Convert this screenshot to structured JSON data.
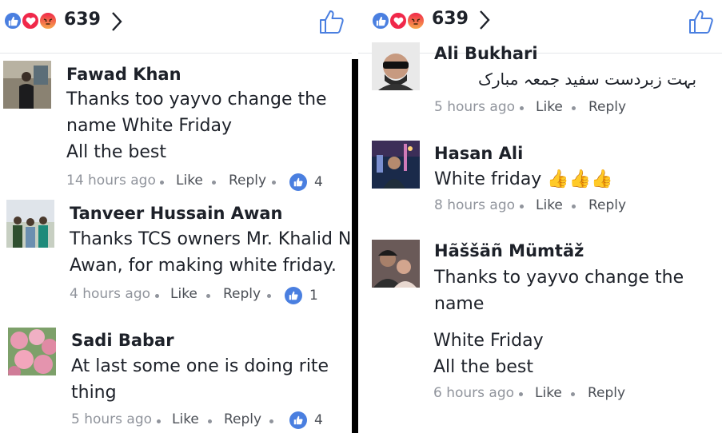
{
  "left_panel": {
    "reaction_count": "639",
    "comments": [
      {
        "author": "Fawad Khan",
        "lines": [
          "Thanks too yayvo change the",
          "name White Friday",
          "All the best"
        ],
        "time": "14 hours ago",
        "like_label": "Like",
        "reply_label": "Reply",
        "likes": "4"
      },
      {
        "author": "Tanveer Hussain Awan",
        "lines": [
          "Thanks TCS owners Mr. Khalid N",
          "Awan, for making white friday."
        ],
        "time": "4 hours ago",
        "like_label": "Like",
        "reply_label": "Reply",
        "likes": "1"
      },
      {
        "author": "Sadi Babar",
        "lines": [
          "At last some one is doing rite",
          "thing"
        ],
        "time": "5 hours ago",
        "like_label": "Like",
        "reply_label": "Reply",
        "likes": "4"
      }
    ]
  },
  "right_panel": {
    "reaction_count": "639",
    "comments": [
      {
        "author": "Ali Bukhari",
        "lines": [
          "بہت زبردست سفید جمعہ مبارک"
        ],
        "time": "5 hours ago",
        "like_label": "Like",
        "reply_label": "Reply"
      },
      {
        "author": "Hasan Ali",
        "lines": [
          "White friday 👍👍👍"
        ],
        "time": "8 hours ago",
        "like_label": "Like",
        "reply_label": "Reply"
      },
      {
        "author": "Hãššäñ Mümtäž",
        "lines": [
          "Thanks to yayvo change the",
          "name",
          "White Friday",
          "All the best"
        ],
        "time": "6 hours ago",
        "like_label": "Like",
        "reply_label": "Reply"
      }
    ]
  },
  "colors": {
    "like_blue": "#4a7fe0",
    "love_red": "#f0284a",
    "angry_orange": "#f7714c",
    "meta_gray": "#90949c",
    "text_dark": "#1d2129"
  },
  "icons": [
    "like-reaction-icon",
    "love-reaction-icon",
    "angry-reaction-icon",
    "chevron-right-icon",
    "thumbs-up-outline-icon",
    "like-badge-icon"
  ]
}
